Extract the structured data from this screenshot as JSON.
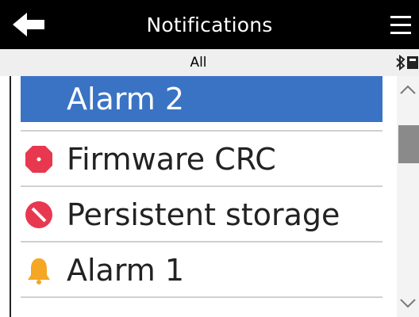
{
  "header": {
    "title": "Notifications",
    "back_icon": "arrow-left-icon",
    "menu_icon": "hamburger-menu-icon"
  },
  "filter": {
    "label": "All",
    "status_icons": [
      "bluetooth-icon",
      "clock-icon"
    ]
  },
  "notifications": [
    {
      "label": "Alarm 2",
      "icon": "none",
      "selected": true
    },
    {
      "label": "Firmware CRC",
      "icon": "fault-icon",
      "color": "#e8384f"
    },
    {
      "label": "Persistent storage",
      "icon": "prohibited-icon",
      "color": "#e8384f"
    },
    {
      "label": "Alarm 1",
      "icon": "bell-icon",
      "color": "#f5a623"
    }
  ],
  "colors": {
    "header_bg": "#000000",
    "selection": "#3a73c4",
    "error": "#e8384f",
    "warning": "#f5a623"
  }
}
